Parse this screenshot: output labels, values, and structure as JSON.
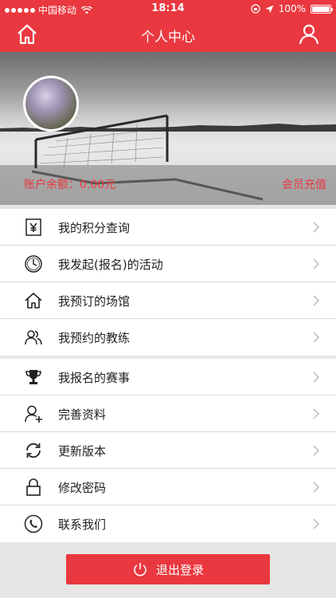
{
  "status_bar": {
    "carrier": "中国移动",
    "time": "18:14",
    "battery": "100%"
  },
  "nav": {
    "title": "个人中心",
    "home_icon": "home-icon",
    "user_icon": "user-icon"
  },
  "profile": {
    "balance": "账户余额：0.00元",
    "recharge": "会员充值"
  },
  "menu_group_1": [
    {
      "label": "我的积分查询",
      "icon": "yen-icon"
    },
    {
      "label": "我发起(报名)的活动",
      "icon": "clock-icon"
    },
    {
      "label": "我预订的场馆",
      "icon": "home-icon"
    },
    {
      "label": "我预约的教练",
      "icon": "users-icon"
    }
  ],
  "menu_group_2": [
    {
      "label": "我报名的赛事",
      "icon": "trophy-icon"
    },
    {
      "label": "完善资料",
      "icon": "user-add-icon"
    },
    {
      "label": "更新版本",
      "icon": "refresh-icon"
    },
    {
      "label": "修改密码",
      "icon": "lock-icon"
    },
    {
      "label": "联系我们",
      "icon": "phone-icon"
    }
  ],
  "logout": {
    "label": "退出登录"
  },
  "colors": {
    "accent": "#e9383f"
  }
}
